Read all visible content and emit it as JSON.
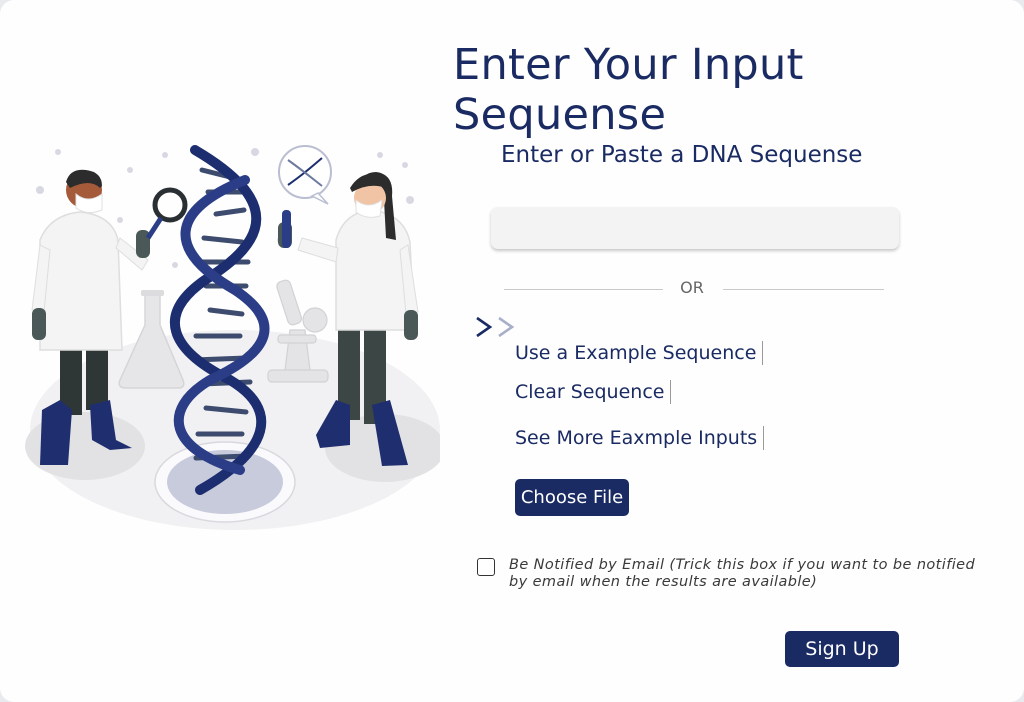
{
  "page": {
    "title": "Enter Your Input Sequense",
    "subheading": "Enter or Paste a DNA Sequense"
  },
  "sequence_input": {
    "value": "",
    "placeholder": ""
  },
  "divider": {
    "label": "OR"
  },
  "links": {
    "example": "Use a Example Sequence",
    "clear": "Clear Sequence",
    "more": "See More Eaxmple Inputs"
  },
  "buttons": {
    "choose_file": "Choose File",
    "sign_up": "Sign Up"
  },
  "notify": {
    "checked": false,
    "label": "Be Notified by Email (Trick this box if you want to be notified by email when the results are available)"
  },
  "icons": {
    "chevrons": "double-chevron-right-icon",
    "illustration": "scientists-dna-illustration"
  },
  "colors": {
    "primary": "#1a2b63",
    "chevron_light": "#a7b0c8",
    "input_bg": "#f3f3f3"
  }
}
